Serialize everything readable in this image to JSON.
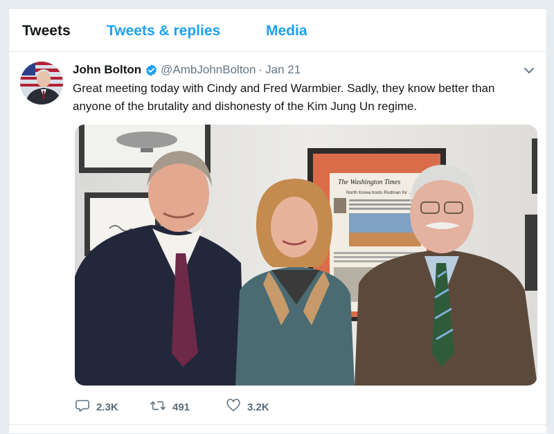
{
  "tabs": {
    "tweets": "Tweets",
    "replies": "Tweets & replies",
    "media": "Media"
  },
  "tweet": {
    "display_name": "John Bolton",
    "handle": "@AmbJohnBolton",
    "separator": "·",
    "timestamp": "Jan 21",
    "text_line1": "Great meeting today with Cindy and Fred Warmbier.  Sadly, they know better than",
    "text_line2": "anyone of the brutality and dishonesty of the Kim Jung Un regime.",
    "newspaper_masthead": "The Washington Times",
    "newspaper_headline": "North Korea hosts Rodman for ..."
  },
  "actions": {
    "replies": "2.3K",
    "retweets": "491",
    "likes": "3.2K"
  },
  "colors": {
    "accent": "#1da1f2",
    "text": "#14171a",
    "muted": "#657786",
    "border": "#e1e8ed",
    "verified": "#1da1f2"
  },
  "icons": {
    "verified": "verified-badge-icon",
    "caret": "chevron-down-icon",
    "reply": "reply-bubble-icon",
    "retweet": "retweet-icon",
    "like": "heart-icon"
  }
}
